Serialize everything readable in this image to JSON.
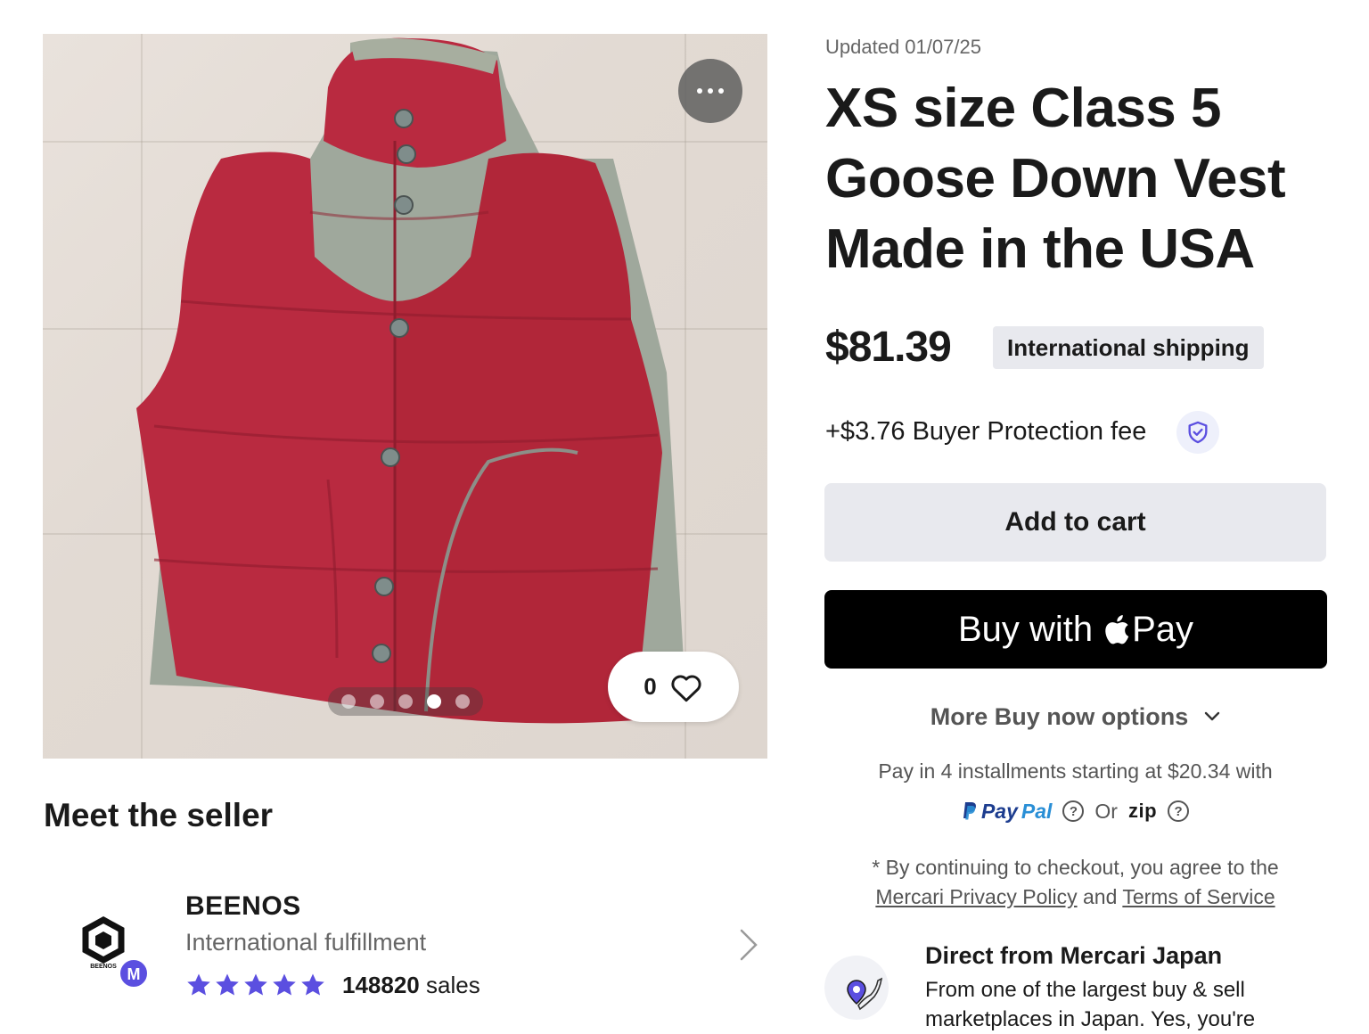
{
  "listing": {
    "updated": "Updated 01/07/25",
    "title": "XS size Class 5 Goose Down Vest Made in the USA",
    "price": "$81.39",
    "shipping_badge": "International shipping",
    "buyer_protection": "+$3.76 Buyer Protection fee",
    "like_count": "0",
    "image_dots": 5,
    "active_dot": 4
  },
  "actions": {
    "add_to_cart": "Add to cart",
    "buy_with": "Buy with",
    "pay": "Pay",
    "more_options": "More Buy now options"
  },
  "payment": {
    "installments": "Pay in 4 installments starting at $20.34 with",
    "paypal_1": "Pay",
    "paypal_2": "Pal",
    "or": "Or",
    "zip": "zip"
  },
  "terms": {
    "prefix": "* By continuing to checkout, you agree to the",
    "privacy": "Mercari Privacy Policy",
    "and": "and",
    "tos": "Terms of Service"
  },
  "seller": {
    "section_title": "Meet the seller",
    "name": "BEENOS",
    "subtitle": "International fulfillment",
    "logo_text": "BEENOS",
    "badge_letter": "M",
    "rating": 5,
    "sales_count": "148820",
    "sales_label": "sales"
  },
  "mercari_japan": {
    "title": "Direct from Mercari Japan",
    "desc": "From one of the largest buy & sell marketplaces in Japan. Yes, you're"
  },
  "colors": {
    "accent_purple": "#5b4fe0",
    "vest_red": "#b8283d",
    "button_gray": "#e8e9ee",
    "apple_pay_black": "#000000"
  }
}
